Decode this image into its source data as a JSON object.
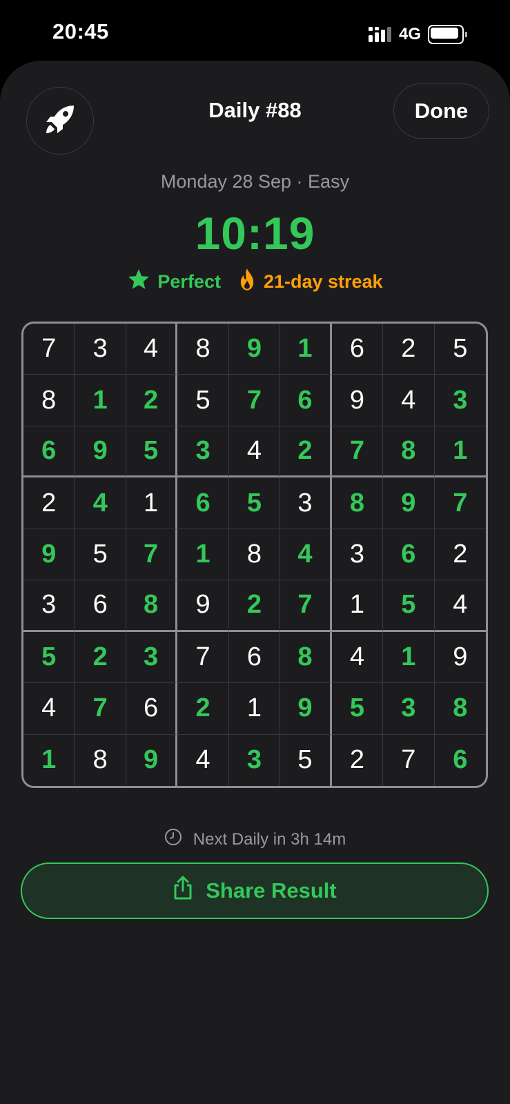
{
  "status_bar": {
    "time": "20:45",
    "network": "4G"
  },
  "header": {
    "title": "Daily #88",
    "done_label": "Done"
  },
  "summary": {
    "subtitle": "Monday 28 Sep · Easy",
    "time": "10:19",
    "perfect_label": "Perfect",
    "streak_label": "21-day streak"
  },
  "grid": {
    "values": [
      [
        7,
        3,
        4,
        8,
        9,
        1,
        6,
        2,
        5
      ],
      [
        8,
        1,
        2,
        5,
        7,
        6,
        9,
        4,
        3
      ],
      [
        6,
        9,
        5,
        3,
        4,
        2,
        7,
        8,
        1
      ],
      [
        2,
        4,
        1,
        6,
        5,
        3,
        8,
        9,
        7
      ],
      [
        9,
        5,
        7,
        1,
        8,
        4,
        3,
        6,
        2
      ],
      [
        3,
        6,
        8,
        9,
        2,
        7,
        1,
        5,
        4
      ],
      [
        5,
        2,
        3,
        7,
        6,
        8,
        4,
        1,
        9
      ],
      [
        4,
        7,
        6,
        2,
        1,
        9,
        5,
        3,
        8
      ],
      [
        1,
        8,
        9,
        4,
        3,
        5,
        2,
        7,
        6
      ]
    ],
    "solved_by_player": [
      [
        0,
        0,
        0,
        0,
        1,
        1,
        0,
        0,
        0
      ],
      [
        0,
        1,
        1,
        0,
        1,
        1,
        0,
        0,
        1
      ],
      [
        1,
        1,
        1,
        1,
        0,
        1,
        1,
        1,
        1
      ],
      [
        0,
        1,
        0,
        1,
        1,
        0,
        1,
        1,
        1
      ],
      [
        1,
        0,
        1,
        1,
        0,
        1,
        0,
        1,
        0
      ],
      [
        0,
        0,
        1,
        0,
        1,
        1,
        0,
        1,
        0
      ],
      [
        1,
        1,
        1,
        0,
        0,
        1,
        0,
        1,
        0
      ],
      [
        0,
        1,
        0,
        1,
        0,
        1,
        1,
        1,
        1
      ],
      [
        1,
        0,
        1,
        0,
        1,
        0,
        0,
        0,
        1
      ]
    ]
  },
  "footer": {
    "next_daily": "Next Daily in 3h 14m",
    "share_label": "Share Result"
  },
  "colors": {
    "accent_green": "#34c759",
    "streak_orange": "#ff9f0a",
    "given_digit": "#ffffff",
    "background": "#1c1c1e"
  },
  "icons": {
    "header_left": "rocket-icon",
    "perfect": "star-icon",
    "streak": "flame-icon",
    "next_daily": "clock-icon",
    "share": "share-icon"
  }
}
